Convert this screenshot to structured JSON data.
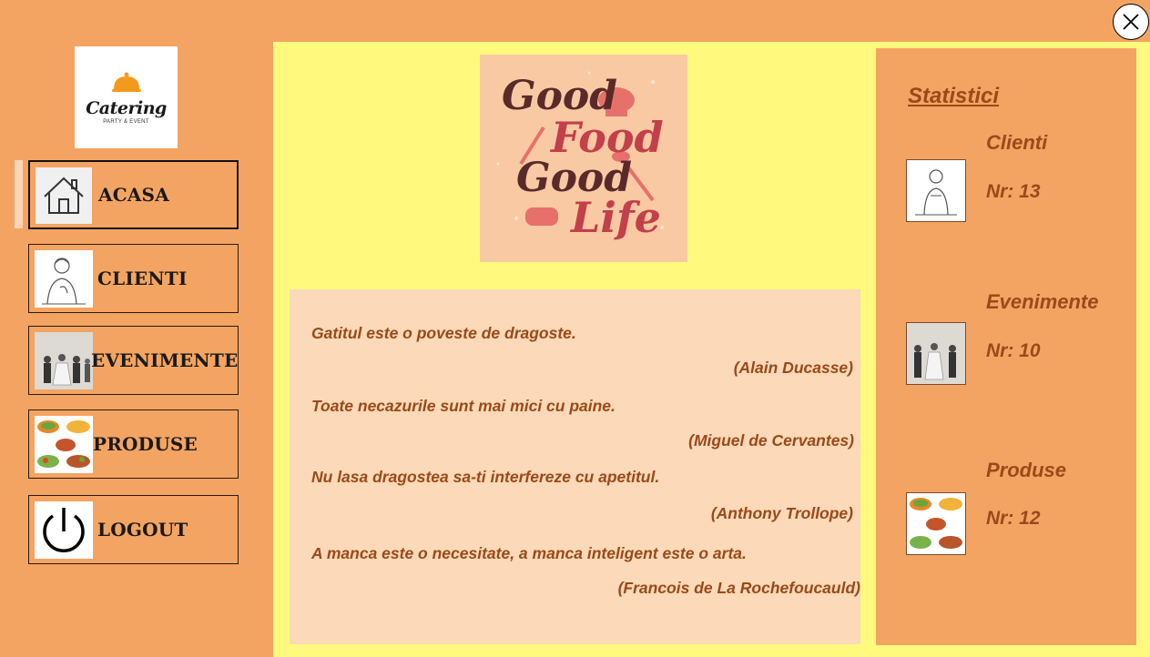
{
  "window": {
    "close_icon": "close-circle-icon"
  },
  "logo": {
    "word": "Catering",
    "sub": "PARTY & EVENT"
  },
  "nav": {
    "items": [
      {
        "label": "ACASA",
        "icon": "home-icon",
        "active": true
      },
      {
        "label": "CLIENTI",
        "icon": "client-icon",
        "active": false
      },
      {
        "label": "EVENIMENTE",
        "icon": "events-icon",
        "active": false
      },
      {
        "label": "PRODUSE",
        "icon": "products-icon",
        "active": false
      },
      {
        "label": "LOGOUT",
        "icon": "power-icon",
        "active": false
      }
    ]
  },
  "poster": {
    "lines": [
      "Good",
      "Food",
      "Good",
      "Life"
    ]
  },
  "quotes": [
    {
      "text": "Gatitul este o poveste de dragoste.",
      "author": "(Alain Ducasse)"
    },
    {
      "text": "Toate necazurile sunt mai mici cu paine.",
      "author": "(Miguel de Cervantes)"
    },
    {
      "text": "Nu lasa dragostea sa-ti interfereze cu apetitul.",
      "author": "(Anthony Trollope)"
    },
    {
      "text": "A manca este o necesitate, a manca inteligent este o arta.",
      "author": "(Francois de La Rochefoucauld)"
    }
  ],
  "stats": {
    "title": "Statistici",
    "items": [
      {
        "label": "Clienti",
        "value": "Nr: 13"
      },
      {
        "label": "Evenimente",
        "value": "Nr: 10"
      },
      {
        "label": "Produse",
        "value": "Nr: 12"
      }
    ]
  },
  "colors": {
    "background": "#f4a462",
    "main_panel": "#fffa7e",
    "quotes_box": "#fcd9b8",
    "accent_text": "#9a4a1a"
  }
}
